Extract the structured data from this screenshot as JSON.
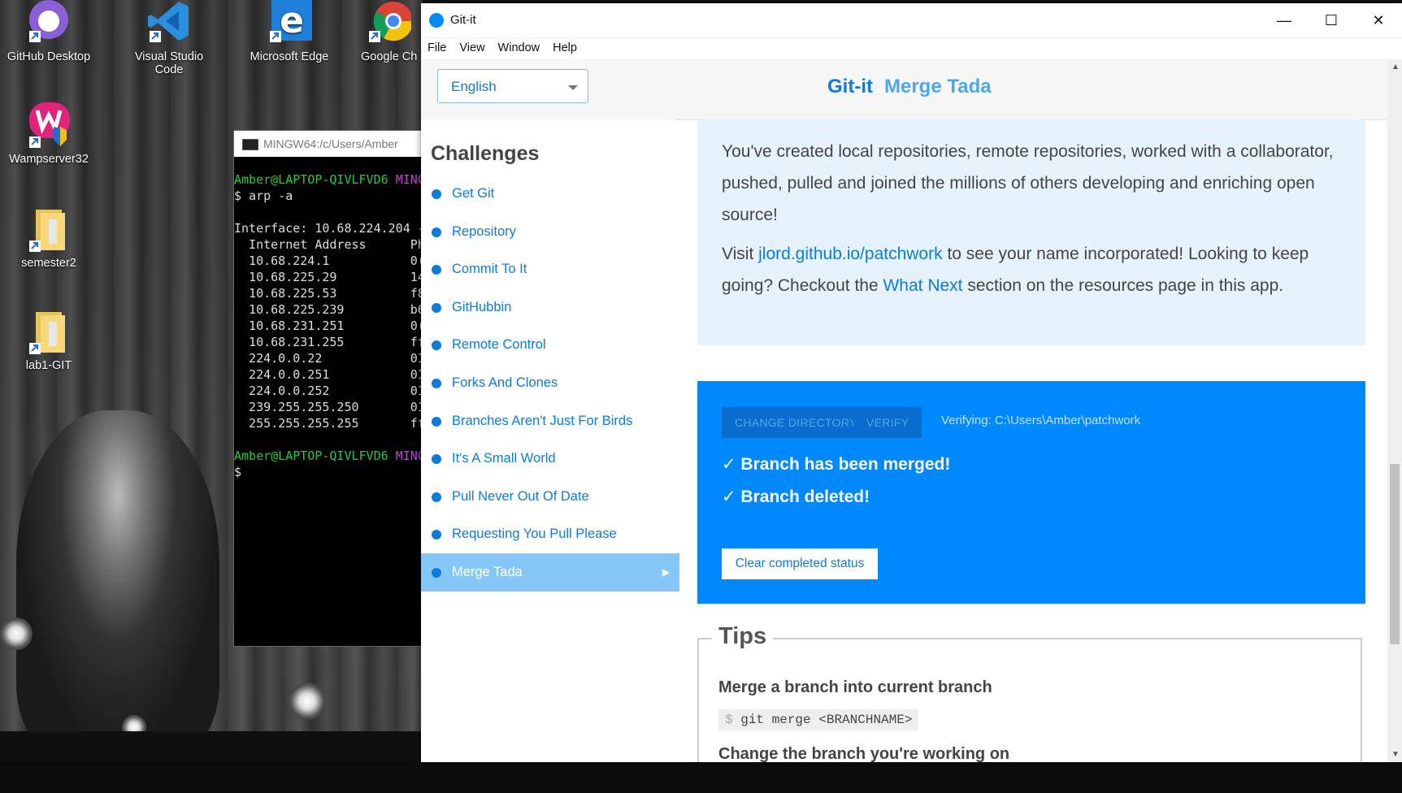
{
  "desktop": {
    "icons": [
      {
        "label": "GitHub Desktop",
        "icon": "github-desktop-icon"
      },
      {
        "label": "Visual Studio Code",
        "icon": "vscode-icon"
      },
      {
        "label": "Microsoft Edge",
        "icon": "edge-icon"
      },
      {
        "label": "Google Ch",
        "icon": "chrome-icon"
      },
      {
        "label": "Wampserver32",
        "icon": "wampserver-icon"
      },
      {
        "label": "semester2",
        "icon": "folder-icon"
      },
      {
        "label": "lab1-GIT",
        "icon": "folder-icon"
      }
    ]
  },
  "terminal": {
    "title": "MINGW64:/c/Users/Amber",
    "prompt_user": "Amber@LAPTOP-QIVLFVD6",
    "prompt_env": "MINC",
    "command": "$ arp -a",
    "interface_line": "Interface: 10.68.224.204 -",
    "header_line": "  Internet Address      Ph",
    "rows": [
      "  10.68.224.1           0(",
      "  10.68.225.29          14",
      "  10.68.225.53          f8",
      "  10.68.225.239         b6",
      "  10.68.231.251         0(",
      "  10.68.231.255         ff",
      "  224.0.0.22            01",
      "  224.0.0.251           01",
      "  224.0.0.252           01",
      "  239.255.255.250       01",
      "  255.255.255.255       ff"
    ],
    "last_prompt": "$"
  },
  "window": {
    "title": "Git-it",
    "minimize": "—",
    "maximize": "☐",
    "close": "✕",
    "menu": [
      "File",
      "View",
      "Window",
      "Help"
    ]
  },
  "header": {
    "language": "English",
    "brand": "Git-it",
    "challenge": "Merge Tada"
  },
  "sidebar": {
    "heading": "Challenges",
    "items": [
      {
        "label": "Get Git"
      },
      {
        "label": "Repository"
      },
      {
        "label": "Commit To It"
      },
      {
        "label": "GitHubbin"
      },
      {
        "label": "Remote Control"
      },
      {
        "label": "Forks And Clones"
      },
      {
        "label": "Branches Aren't Just For Birds"
      },
      {
        "label": "It's A Small World"
      },
      {
        "label": "Pull Never Out Of Date"
      },
      {
        "label": "Requesting You Pull Please"
      },
      {
        "label": "Merge Tada",
        "active": true,
        "arrow": "▶"
      }
    ]
  },
  "completion": {
    "para1": "You've created local repositories, remote repositories, worked with a collaborator, pushed, pulled and joined the millions of others developing and enriching open source!",
    "visit": "Visit",
    "link1": "jlord.github.io/patchwork",
    "after_link1": "to see your name incorporated! Looking to keep going? Checkout the",
    "link2": "What Next",
    "after_link2": "section on the resources page in this app."
  },
  "verify": {
    "change_directory": "CHANGE DIRECTORY",
    "verify": "VERIFY",
    "status": "Verifying: C:\\Users\\Amber\\patchwork",
    "ok1": "✓ Branch has been merged!",
    "ok2": "✓ Branch deleted!",
    "clear": "Clear completed status"
  },
  "tips": {
    "title": "Tips",
    "tip1": "Merge a branch into current branch",
    "cmd_prefix": "$",
    "cmd1": "git merge <BRANCHNAME>",
    "tip2": "Change the branch you're working on"
  },
  "colors": {
    "accent": "#0089ff",
    "link": "#0b7bdc",
    "completion_bg": "#e6f3fd",
    "active_item": "#85c8f8"
  }
}
